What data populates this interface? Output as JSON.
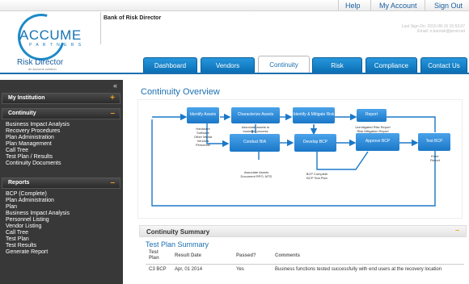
{
  "header": {
    "company": "Bank of Risk Director",
    "links": [
      "Help",
      "My Account",
      "Sign Out"
    ],
    "last_sign_on": "Last Sign On: 2015-08-15 15:53:07",
    "email": "Email: ir.banrisk@prod.net",
    "logo_text": "ACCUME",
    "logo_sub": "P A R T N E R S",
    "brand": "Risk Director",
    "brand_sub": "an Accume solution"
  },
  "tabs": [
    "Dashboard",
    "Vendors",
    "Continuity",
    "Risk",
    "Compliance",
    "Contact Us"
  ],
  "active_tab": "Continuity",
  "sidebar": {
    "collapse": "«",
    "sections": [
      {
        "label": "My Institution",
        "icon": "+",
        "items": []
      },
      {
        "label": "Continuity",
        "icon": "–",
        "items": [
          "Business Impact Analysis",
          "Recovery Procedures",
          "Plan Administration",
          "Plan Management",
          "Call Tree",
          "Test Plan / Results",
          "Continuity Documents"
        ]
      },
      {
        "label": "Reports",
        "icon": "–",
        "items": [
          "BCP (Complete)",
          "Plan Administration",
          "Plan",
          "Business Impact Analysis",
          "Personnel Listing",
          "Vendor Listing",
          "Call Tree",
          "Test Plan",
          "Test Results",
          "Generate Report"
        ]
      }
    ]
  },
  "overview": {
    "title": "Continuity Overview",
    "boxes": [
      "Identify Assets",
      "Characterize Assets",
      "Identify & Mitigate Risk",
      "Report",
      "Conduct BIA",
      "Develop BCP",
      "Approve BCP",
      "Test BCP"
    ],
    "notes": {
      "identify": "Hardware\nSoftware\nOther Media\nVendors\nPersonnel",
      "characterize": "Associate assets to\nbusiness process",
      "report": "Unmitigated Risk Report\nRisk Mitigation Report",
      "bia": "Associate Assets\nDocument RPO, MTD",
      "bcp": "BCP Complete\nBCP Test Plan",
      "test": "Enter\nReport"
    }
  },
  "summary": {
    "title": "Continuity Summary",
    "minimize": "–",
    "sub_title": "Test Plan Summary",
    "columns": [
      "Test Plan",
      "Result Date",
      "Passed?",
      "Comments"
    ],
    "rows": [
      {
        "plan": "C3 BCP",
        "date": "Apr, 01 2014",
        "passed": "Yes",
        "comments": "Business functions tested successfully with end users at the recovery location"
      }
    ]
  }
}
